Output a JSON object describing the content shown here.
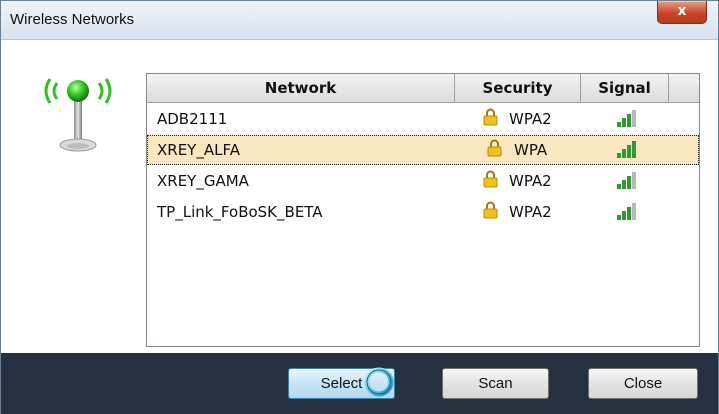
{
  "window": {
    "title": "Wireless Networks",
    "close_label": "x"
  },
  "columns": {
    "network": "Network",
    "security": "Security",
    "signal": "Signal"
  },
  "networks": [
    {
      "name": "ADB2111",
      "security": "WPA2",
      "signal_bars": 3,
      "selected": false
    },
    {
      "name": "XREY_ALFA",
      "security": "WPA",
      "signal_bars": 4,
      "selected": true
    },
    {
      "name": "XREY_GAMA",
      "security": "WPA2",
      "signal_bars": 3,
      "selected": false
    },
    {
      "name": "TP_Link_FoBoSK_BETA",
      "security": "WPA2",
      "signal_bars": 3,
      "selected": false
    }
  ],
  "buttons": {
    "select": "Select",
    "scan": "Scan",
    "close": "Close"
  },
  "icons": {
    "antenna": "wireless-antenna-icon",
    "lock": "lock-icon",
    "signal": "signal-strength-icon",
    "busy": "busy-spinner-icon"
  },
  "colors": {
    "selection": "#fbe7bf",
    "footer": "#25313f",
    "signal_on": "#2f9a2f",
    "signal_off": "#b8b8b8"
  }
}
